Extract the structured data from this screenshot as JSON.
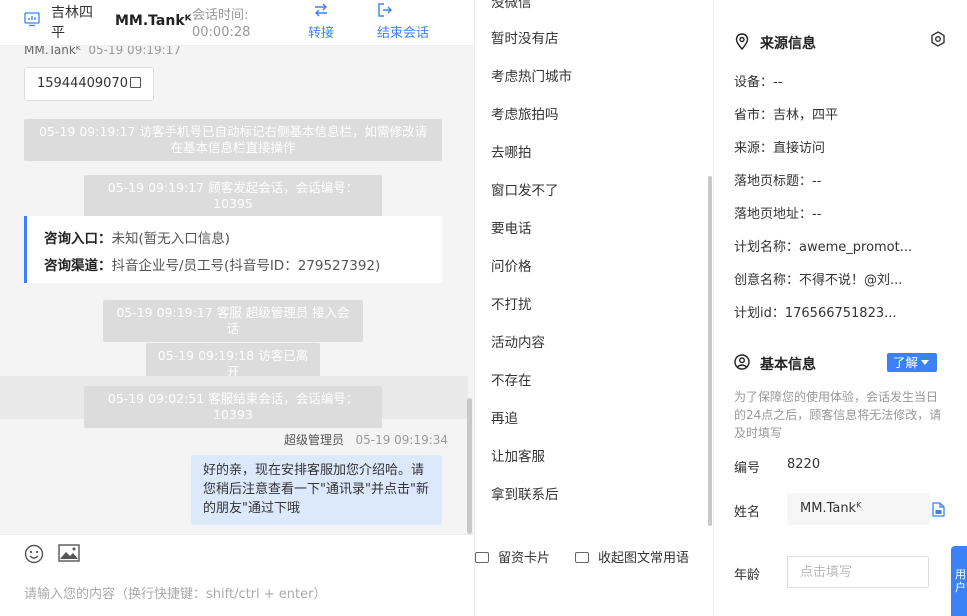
{
  "header": {
    "location": "吉林四平",
    "customer_name": "MM.Tankᴷ",
    "time_label": "会话时间:",
    "time_value": "00:00:28",
    "transfer_label": "转接",
    "end_label": "结束会话"
  },
  "chat": {
    "messages": {
      "m1_name": "MM.Tankᴷ",
      "m1_time": "05-19 09:19:17",
      "phone": "15944409070",
      "sys1": "05-19 09:19:17 访客手机号已自动标记右侧基本信息栏，如需修改请在基本信息栏直接操作",
      "sys2": "05-19 09:19:17 顾客发起会话，会话编号：10395",
      "card_entry_key": "咨询入口：",
      "card_entry_val": "未知(暂无入口信息)",
      "card_channel_key": "咨询渠道：",
      "card_channel_val": "抖音企业号/员工号(抖音号ID：279527392)",
      "sys3": "05-19 09:19:17 客服 超级管理员 接入会话",
      "sys4": "05-19 09:19:18 访客已离开",
      "sys5": "05-19 09:02:51 客服结束会话，会话编号：10393",
      "agent_name": "超级管理员",
      "agent_time": "05-19 09:19:34",
      "agent_text": "好的亲，现在安排客服加您介绍哈。请您稍后注意查看一下\"通讯录\"并点击\"新的朋友\"通过下哦"
    },
    "input_placeholder": "请输入您的内容（换行快捷键：shift/ctrl + enter）"
  },
  "phrases": {
    "top_partial": "没微信",
    "items": [
      "暂时没有店",
      "考虑热门城市",
      "考虑旅拍吗",
      "去哪拍",
      "窗口发不了",
      "要电话",
      "问价格",
      "不打扰",
      "活动内容",
      "不存在",
      "再追",
      "让加客服",
      "拿到联系后"
    ],
    "card_label": "留资卡片",
    "collapse_label": "收起图文常用语"
  },
  "source": {
    "title": "来源信息",
    "device": "设备：--",
    "region": "省市：吉林，四平",
    "source": "来源：直接访问",
    "landing_title": "落地页标题：--",
    "landing_url": "落地页地址：--",
    "plan_name": "计划名称：aweme_promot...",
    "creative_name": "创意名称：不得不说！@刘...",
    "plan_id": "计划id：176566751823..."
  },
  "basic": {
    "title": "基本信息",
    "learn_label": "了解",
    "notice": "为了保障您的使用体验，会话发生当日的24点之后，顾客信息将无法修改，请及时填写",
    "id_label": "编号",
    "id_value": "8220",
    "name_label": "姓名",
    "name_value": "MM.Tankᴷ",
    "age_label": "年龄",
    "age_placeholder": "点击填写",
    "side_tab": "用户"
  },
  "colors": {
    "accent": "#3b82f6",
    "bubble": "#dce9fd",
    "system_msg": "#dcdcdc"
  }
}
